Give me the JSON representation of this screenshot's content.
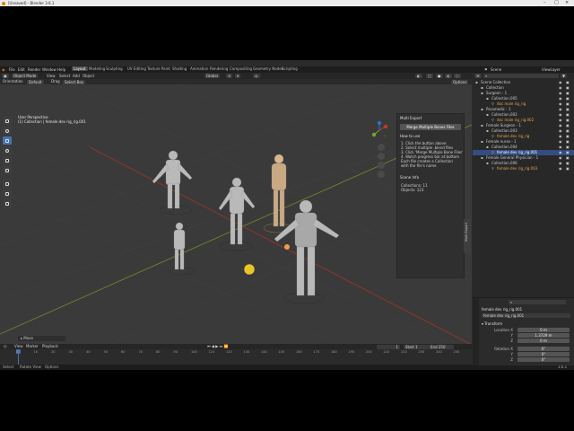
{
  "window": {
    "title": "[Unsaved] - Blender 3.6.1"
  },
  "menu": [
    "File",
    "Edit",
    "Render",
    "Window",
    "Help"
  ],
  "workspaces": [
    "Layout",
    "Modeling",
    "Sculpting",
    "UV Editing",
    "Texture Paint",
    "Shading",
    "Animation",
    "Rendering",
    "Compositing",
    "Geometry Nodes",
    "Scripting"
  ],
  "active_workspace": "Layout",
  "scene": {
    "label": "Scene",
    "view_layer": "ViewLayer"
  },
  "viewport": {
    "header": {
      "mode": "Object Mode",
      "menus": [
        "View",
        "Select",
        "Add",
        "Object"
      ],
      "transform": "Global",
      "options": "Options"
    },
    "header2": {
      "orientation": "Orientation",
      "orientation_value": "Default",
      "drag": "Drag",
      "drag_value": "Select Box"
    },
    "info_line1": "User Perspective",
    "info_line2": "(1) Collection | female dev rig_rig.001",
    "last_op": "Move"
  },
  "npanel": {
    "title": "Multi Export",
    "merge_button": "Merge Multiple Bones Files",
    "how_title": "How to use",
    "steps": [
      "1. Click the button above",
      "2. Select multiple .blend files",
      "3. Click 'Merge Multiple Bone Files'",
      "4. Watch progress bar at bottom",
      "Each file creates a Collection",
      "with the file's name"
    ],
    "scene_info_title": "Scene Info",
    "collections": "Collections: 11",
    "objects": "Objects: 123",
    "tab": "Multi Export"
  },
  "timeline": {
    "menus": [
      "View",
      "Marker",
      "Playback"
    ],
    "frame": "1",
    "start_label": "Start",
    "start": "1",
    "end_label": "End",
    "end": "250",
    "ticks": [
      "0",
      "10",
      "20",
      "30",
      "40",
      "50",
      "60",
      "70",
      "80",
      "90",
      "100",
      "110",
      "120",
      "130",
      "140",
      "150",
      "160",
      "170",
      "180",
      "190",
      "200",
      "210",
      "220",
      "230",
      "240",
      "250"
    ]
  },
  "status": {
    "select": "Select",
    "rotate": "Rotate View",
    "options": "Options",
    "version": "3.6.1"
  },
  "outliner": {
    "rows": [
      {
        "indent": 0,
        "label": "Scene Collection",
        "color": "#cccccc"
      },
      {
        "indent": 1,
        "label": "Collection",
        "color": "#cccccc"
      },
      {
        "indent": 1,
        "label": "Surgeon - 1",
        "color": "#cccccc"
      },
      {
        "indent": 2,
        "label": "Collection.005",
        "color": "#cccccc"
      },
      {
        "indent": 3,
        "label": "doc male rig_rig",
        "color": "#e8a34a"
      },
      {
        "indent": 1,
        "label": "Paramedic - 1",
        "color": "#cccccc"
      },
      {
        "indent": 2,
        "label": "Collection.002",
        "color": "#cccccc"
      },
      {
        "indent": 3,
        "label": "doc male rig_rig.002",
        "color": "#e8a34a"
      },
      {
        "indent": 1,
        "label": "Female Surgeon - 1",
        "color": "#cccccc"
      },
      {
        "indent": 2,
        "label": "Collection.003",
        "color": "#cccccc"
      },
      {
        "indent": 3,
        "label": "female dev rig_rig",
        "color": "#e8a34a"
      },
      {
        "indent": 1,
        "label": "Female nurse - 1",
        "color": "#cccccc"
      },
      {
        "indent": 2,
        "label": "Collection.004",
        "color": "#cccccc"
      },
      {
        "indent": 3,
        "label": "female dev rig_rig.001",
        "color": "#ffffff",
        "selected": true
      },
      {
        "indent": 1,
        "label": "Female General Physician - 1",
        "color": "#cccccc"
      },
      {
        "indent": 2,
        "label": "Collection.006",
        "color": "#cccccc"
      },
      {
        "indent": 3,
        "label": "female dev rig_rig.003",
        "color": "#e8a34a"
      }
    ]
  },
  "properties": {
    "object_name": "female dev rig_rig.001",
    "object_name2": "female dev rig_rig.001",
    "section": "Transform",
    "location_label": "Location X",
    "location": [
      "0 m",
      "1.3729 m",
      "0 m"
    ],
    "rotation_label": "Rotation X",
    "rotation": [
      "0°",
      "0°",
      "0°"
    ],
    "axis": [
      "X",
      "Y",
      "Z"
    ],
    "y_label": "Y",
    "z_label": "Z"
  },
  "colors": {
    "accent": "#4772b3",
    "selected_orange": "#e8a34a",
    "x_axis": "#c0392b",
    "y_axis": "#7aa32d"
  }
}
